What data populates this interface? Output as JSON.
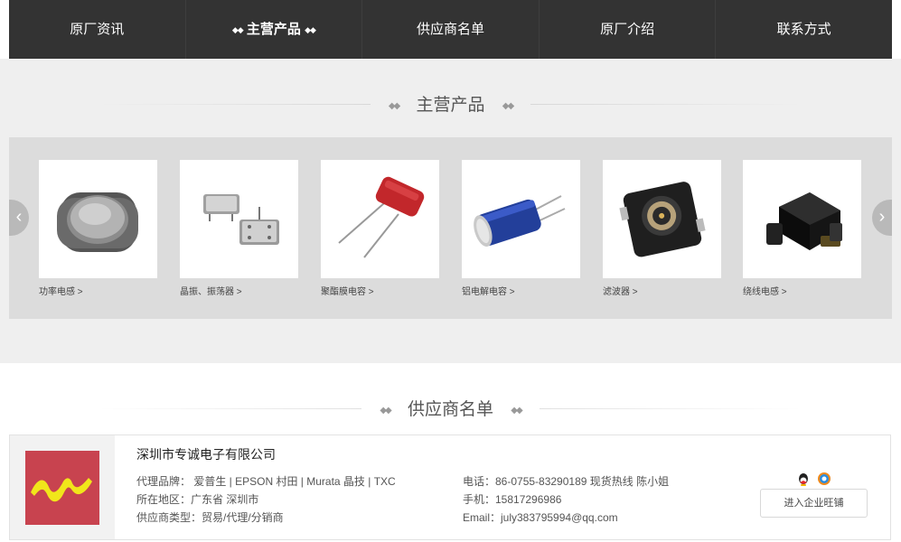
{
  "nav": {
    "items": [
      {
        "label": "原厂资讯"
      },
      {
        "label": "主营产品"
      },
      {
        "label": "供应商名单"
      },
      {
        "label": "原厂介绍"
      },
      {
        "label": "联系方式"
      }
    ],
    "active_index": 1,
    "active_deco": "◆◆"
  },
  "products_section": {
    "title": "主营产品",
    "deco": "◆◆",
    "prev_arrow": "‹",
    "next_arrow": "›",
    "items": [
      {
        "label": "功率电感 >",
        "icon": "power-inductor-image"
      },
      {
        "label": "晶振、振荡器 >",
        "icon": "crystal-oscillator-image"
      },
      {
        "label": "聚酯膜电容 >",
        "icon": "polyester-film-capacitor-image"
      },
      {
        "label": "铝电解电容 >",
        "icon": "aluminum-electrolytic-capacitor-image"
      },
      {
        "label": "滤波器 >",
        "icon": "filter-image"
      },
      {
        "label": "绕线电感 >",
        "icon": "wirewound-inductor-image"
      }
    ]
  },
  "suppliers_section": {
    "title": "供应商名单",
    "deco": "◆◆"
  },
  "supplier": {
    "company": "深圳市专诚电子有限公司",
    "brands": "代理品牌： 爱普生 | EPSON   村田 | Murata   晶技 | TXC",
    "region": "所在地区：广东省 深圳市",
    "type": "供应商类型：贸易/代理/分销商",
    "phone": "电话：86-0755-83290189 现货热线 陈小姐",
    "mobile": "手机：15817296986",
    "email": "Email：july383795994@qq.com",
    "shop_button": "进入企业旺铺",
    "colors": {
      "logo_bg": "#c8434f",
      "logo_mark": "#f1e61a"
    }
  }
}
